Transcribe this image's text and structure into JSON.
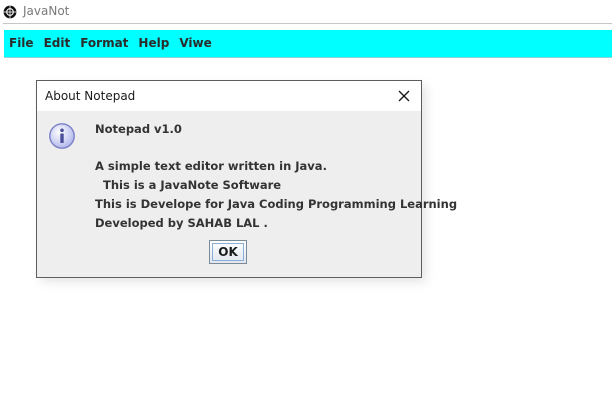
{
  "app": {
    "title": "JavaNot"
  },
  "menu": {
    "items": [
      "File",
      "Edit",
      "Format",
      "Help",
      "Viwe"
    ]
  },
  "dialog": {
    "title": "About Notepad",
    "message_lines": [
      "Notepad v1.0",
      "A simple text editor written in Java.",
      "  This is a JavaNote Software",
      "This is Develope for Java Coding Programming Learning",
      "Developed by SAHAB LAL ."
    ],
    "ok_label": "OK",
    "icon": "info-icon",
    "close_icon": "close-icon"
  },
  "colors": {
    "menu_bar": "#00ffff",
    "dialog_background": "#eeeeee",
    "window_background": "#ffffff"
  }
}
